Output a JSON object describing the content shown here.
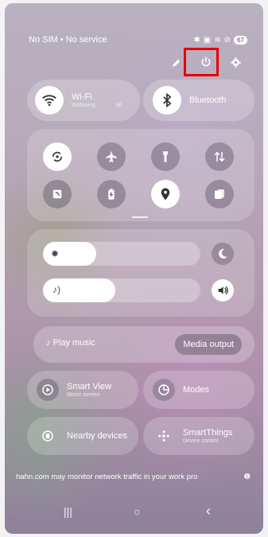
{
  "status": {
    "left": "No SIM • No service",
    "battery": "67"
  },
  "toolbar": {
    "edit_icon": "pencil-icon",
    "power_icon": "power-icon",
    "settings_icon": "gear-icon"
  },
  "wifi": {
    "label": "Wi-Fi",
    "sub": "Wohnung",
    "sub2": "Wi"
  },
  "bluetooth": {
    "label": "Bluetooth"
  },
  "quick_settings": [
    "auto-rotate",
    "airplane-mode",
    "flashlight",
    "mobile-data",
    "nfc",
    "battery-saver",
    "location",
    "secure-folder"
  ],
  "sliders": {
    "brightness_level": 0.34,
    "volume_level": 0.46
  },
  "media": {
    "play_label": "Play music",
    "output_label": "Media output"
  },
  "tiles": {
    "smart_view": {
      "label": "Smart View",
      "sub": "Mirror screen"
    },
    "modes": {
      "label": "Modes"
    },
    "nearby": {
      "label": "Nearby devices"
    },
    "smartthings": {
      "label": "SmartThings",
      "sub": "Device control"
    }
  },
  "notice": "hahn.com may monitor network traffic in your work pro",
  "nav": {
    "recent": "|||",
    "home": "○",
    "back": "‹"
  },
  "colors": {
    "highlight": "#e60000"
  }
}
